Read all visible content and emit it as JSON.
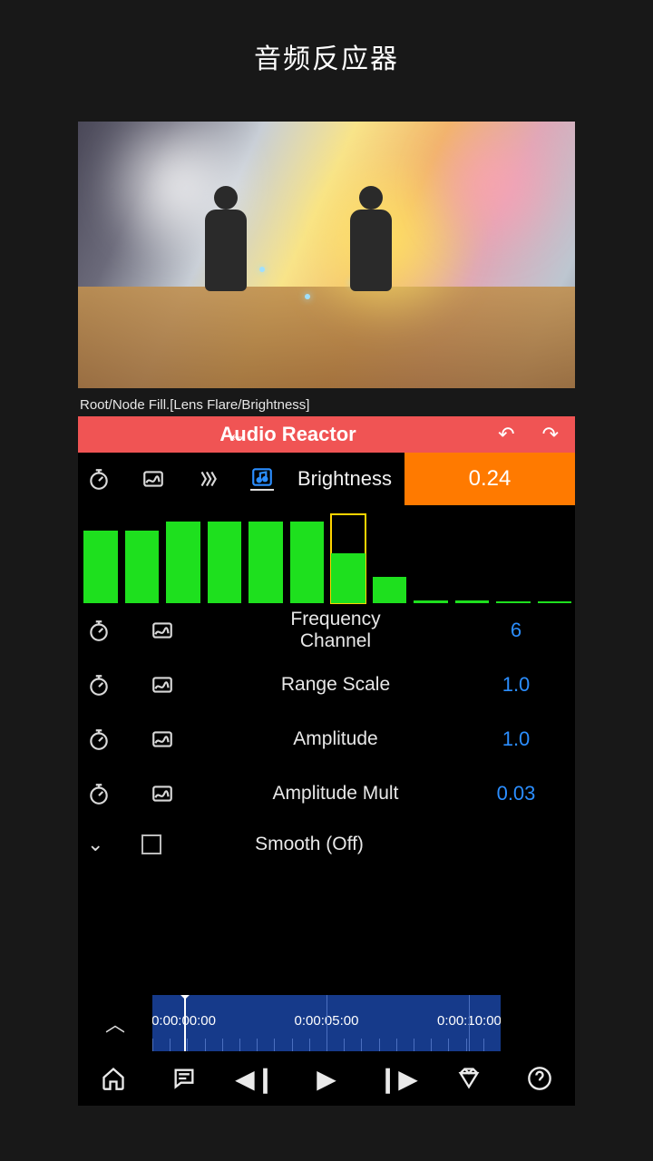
{
  "page_title": "音频反应器",
  "breadcrumb": "Root/Node Fill.[Lens Flare/Brightness]",
  "header": {
    "title": "Audio Reactor"
  },
  "brightness": {
    "label": "Brightness",
    "value": "0.24"
  },
  "chart_data": {
    "type": "bar",
    "categories": [
      "1",
      "2",
      "3",
      "4",
      "5",
      "6",
      "7",
      "8",
      "9",
      "10",
      "11",
      "12"
    ],
    "values": [
      82,
      82,
      92,
      92,
      92,
      92,
      98,
      30,
      3,
      3,
      2,
      2
    ],
    "selected_index": 6,
    "selected_fill_height": 55,
    "ylim": [
      0,
      100
    ],
    "title": "Frequency Channel levels"
  },
  "params": [
    {
      "label": "Frequency\nChannel",
      "value": "6"
    },
    {
      "label": "Range Scale",
      "value": "1.0"
    },
    {
      "label": "Amplitude",
      "value": "1.0"
    },
    {
      "label": "Amplitude Mult",
      "value": "0.03"
    }
  ],
  "smooth": {
    "label": "Smooth (Off)"
  },
  "timeline": {
    "labels": [
      "0:00:00:00",
      "0:00:05:00",
      "0:00:10:00"
    ],
    "playhead_pct": 9
  }
}
